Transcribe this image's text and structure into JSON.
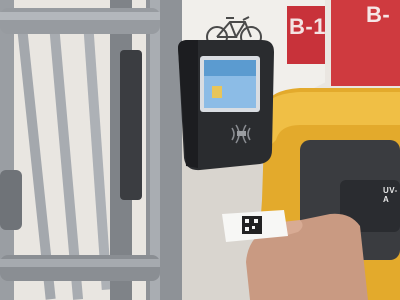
{
  "scene": {
    "wall_sign_left": "B-1",
    "wall_sign_right": "B-",
    "machine_label": "UV-A",
    "colors": {
      "wall": "#ece9e4",
      "floor": "#d7d3cc",
      "railing": "#8d9196",
      "reader_body": "#2a2c2f",
      "screen": "#6fa7d6",
      "yellow_machine": "#e0a72b",
      "red_sign": "#c8323a",
      "skin": "#c99a82"
    },
    "icons": [
      "bicycle-icon",
      "nfc-contactless-icon",
      "qr-code-icon"
    ]
  }
}
